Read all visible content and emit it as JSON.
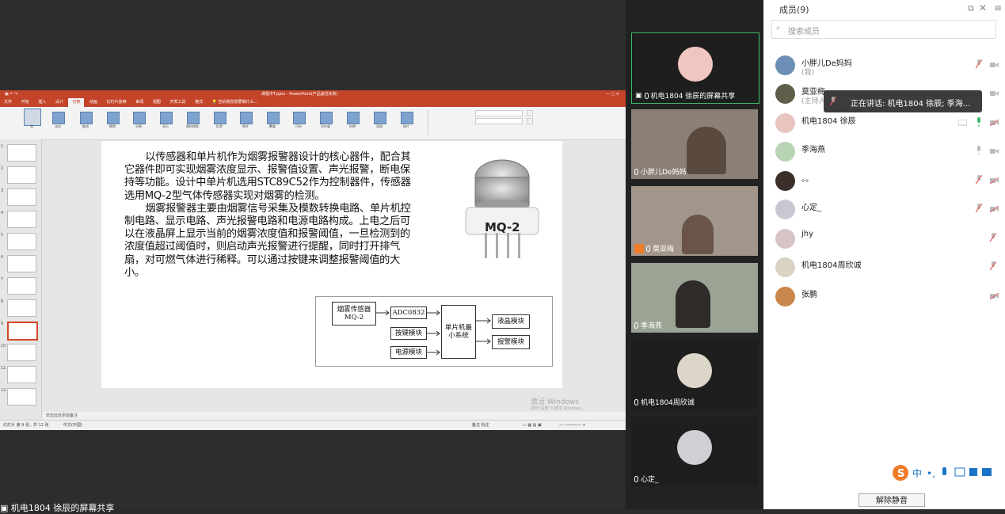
{
  "ppt": {
    "title": "课程中T.pptx - PowerPoint(产品激活失败)",
    "tabs": [
      "文件",
      "开始",
      "插入",
      "设计",
      "切换",
      "动画",
      "幻灯片放映",
      "审阅",
      "视图",
      "开发工具",
      "格式"
    ],
    "active_tab": "切换",
    "tell_me": "告诉我您想要做什么...",
    "ribbon_items": [
      "无",
      "淡出",
      "推进",
      "擦除",
      "分割",
      "显示",
      "随机线条",
      "形状",
      "揭开",
      "覆盖",
      "闪光",
      "百叶窗",
      "时钟",
      "涡流",
      "碎片"
    ],
    "thumb_numbers": [
      "1",
      "2",
      "3",
      "4",
      "5",
      "6",
      "7",
      "8",
      "9",
      "10",
      "11",
      "12"
    ],
    "notes": "单击此处添加备注",
    "status_left": "幻灯片 第 9 张，共 12 张",
    "status_lang": "中文(中国)",
    "status_right": "备注  批注",
    "windows_activate": "激活 Windows",
    "windows_activate_sub": "转到“设置”以激活 Windows。"
  },
  "slide": {
    "para1": "以传感器和单片机作为烟雾报警器设计的核心器件，配合其它器件即可实现烟雾浓度显示、报警值设置、声光报警，断电保持等功能。设计中单片机选用STC89C52作为控制器件，传感器选用MQ-2型气体传感器实现对烟雾的检测。",
    "para2": "烟雾报警器主要由烟雾信号采集及模数转换电路、单片机控制电路、显示电路、声光报警电路和电源电路构成。上电之后可以在液晶屏上显示当前的烟雾浓度值和报警阈值，一旦检测到的浓度值超过阈值时，则启动声光报警进行提醒，同时打开排气扇，对可燃气体进行稀释。可以通过按键来调整报警阈值的大小。",
    "sensor_label": "MQ-2",
    "diagram": {
      "sensor": "烟雾传感器MQ-2",
      "adc": "ADC0832",
      "key": "按键模块",
      "power": "电源模块",
      "mcu": "单片机最小系统",
      "lcd": "液晶模块",
      "alarm": "报警模块"
    }
  },
  "share_label": "机电1804 徐辰的屏幕共享",
  "videos": [
    {
      "name": "机电1804 徐辰的屏幕共享",
      "avatar_color": "#f2c6c0"
    },
    {
      "name": "小胖儿De妈妈",
      "avatar_color": "#c9a88a"
    },
    {
      "name": "莫亚梅",
      "avatar_color": "#b89a8a"
    },
    {
      "name": "季海燕",
      "avatar_color": "#b9c4b0"
    },
    {
      "name": "机电1804周欣诚",
      "avatar_color": "#dcd6c8"
    },
    {
      "name": "心定_",
      "avatar_color": "#cfcfd6"
    }
  ],
  "panel": {
    "title": "成员(9)",
    "search_placeholder": "搜索成员",
    "members": [
      {
        "name": "小胖儿De妈妈",
        "sub": "(我)",
        "avatar_color": "#6d8fb5"
      },
      {
        "name": "莫亚梅",
        "sub": "(主持人)",
        "avatar_color": "#5e5e4a"
      },
      {
        "name": "机电1804 徐辰",
        "sub": "",
        "avatar_color": "#e8c5bf"
      },
      {
        "name": "季海燕",
        "sub": "",
        "avatar_color": "#b8d4b4"
      },
      {
        "name": "。。",
        "sub": "",
        "avatar_color": "#3a2f2a"
      },
      {
        "name": "心定_",
        "sub": "",
        "avatar_color": "#c8c8d2"
      },
      {
        "name": "jhy",
        "sub": "",
        "avatar_color": "#d6c4c4"
      },
      {
        "name": "机电1804周欣诚",
        "sub": "",
        "avatar_color": "#d9d3c4"
      },
      {
        "name": "张鹏",
        "sub": "",
        "avatar_color": "#c9874c"
      }
    ],
    "tooltip": "正在讲话: 机电1804 徐辰; 季海...",
    "unmute_button": "解除静音"
  },
  "colors": {
    "ppt_accent": "#c4442a",
    "active_tile_border": "#3dbb6a",
    "muted_red": "#e05a5a",
    "mic_green": "#3dbb6a"
  }
}
